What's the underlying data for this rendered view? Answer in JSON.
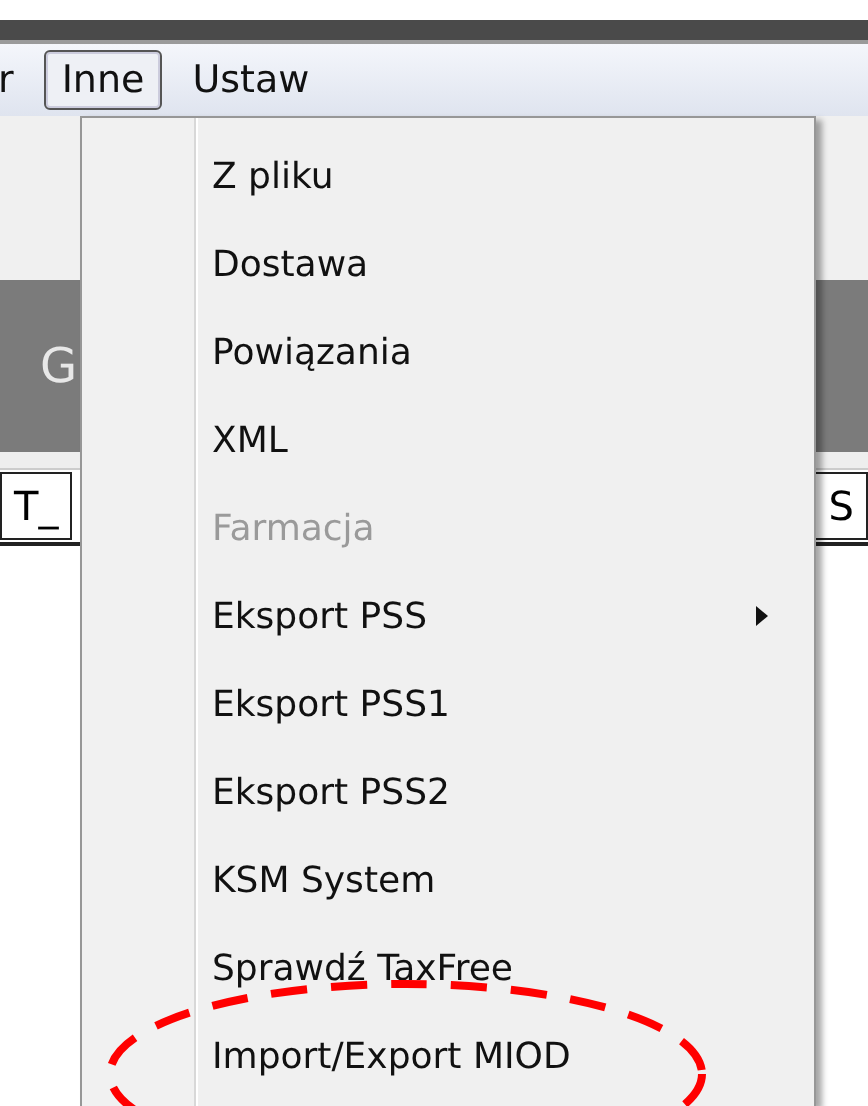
{
  "menubar": [
    {
      "label": "r",
      "selected": false
    },
    {
      "label": "Inne",
      "selected": true
    },
    {
      "label": "Ustaw",
      "selected": false
    }
  ],
  "background": {
    "band_text": "G",
    "columns": [
      "T_",
      "S"
    ]
  },
  "menu": [
    {
      "label": "Z pliku",
      "disabled": false,
      "kind": "item"
    },
    {
      "label": "Dostawa",
      "disabled": false,
      "kind": "item"
    },
    {
      "label": "Powiązania",
      "disabled": false,
      "kind": "item"
    },
    {
      "label": "XML",
      "disabled": false,
      "kind": "item"
    },
    {
      "label": "Farmacja",
      "disabled": true,
      "kind": "item"
    },
    {
      "label": "Eksport PSS",
      "disabled": false,
      "kind": "submenu"
    },
    {
      "label": "Eksport PSS1",
      "disabled": false,
      "kind": "item"
    },
    {
      "label": "Eksport PSS2",
      "disabled": false,
      "kind": "item"
    },
    {
      "label": "KSM System",
      "disabled": false,
      "kind": "item"
    },
    {
      "label": "Sprawdź TaxFree",
      "disabled": false,
      "kind": "item"
    },
    {
      "label": "Import/Export MIOD",
      "disabled": false,
      "kind": "item"
    }
  ]
}
